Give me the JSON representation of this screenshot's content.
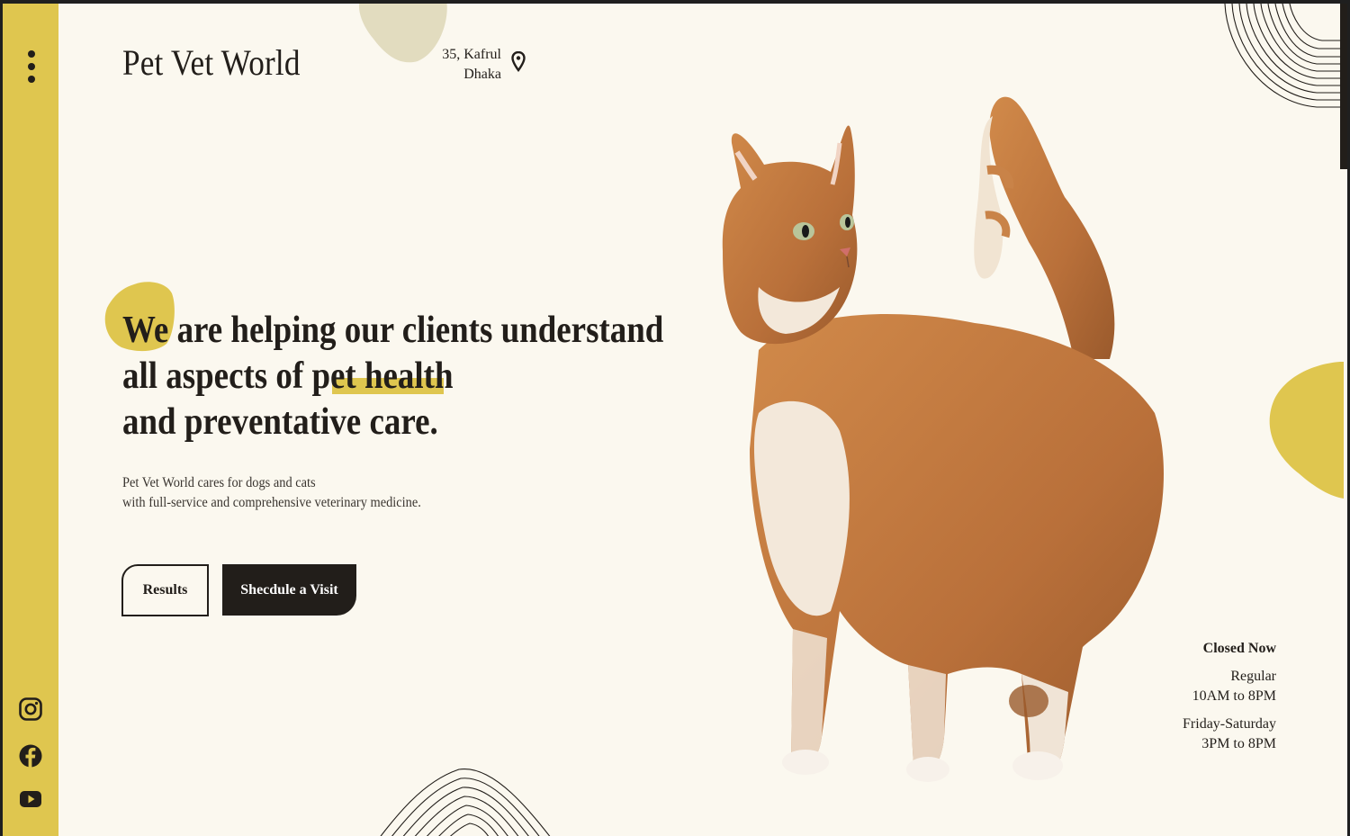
{
  "brand": {
    "name": "Pet Vet World"
  },
  "address": {
    "line1": "35, Kafrul",
    "line2": "Dhaka"
  },
  "hero": {
    "headline_line1": "We are helping our clients understand",
    "headline_line2": "all aspects of pet health",
    "headline_line3": "and preventative care.",
    "sub_line1": "Pet Vet World cares for dogs and cats",
    "sub_line2": "with full-service and comprehensive veterinary medicine."
  },
  "buttons": {
    "results": "Results",
    "schedule": "Shecdule a Visit"
  },
  "hours": {
    "status": "Closed Now",
    "regular_label": "Regular",
    "regular_time": "10AM to 8PM",
    "weekend_label": "Friday-Saturday",
    "weekend_time": "3PM to 8PM"
  },
  "icons": {
    "menu": "more-vertical-icon",
    "location": "map-pin-icon",
    "instagram": "instagram-icon",
    "facebook": "facebook-icon",
    "youtube": "youtube-icon"
  },
  "colors": {
    "accent": "#dfc64f",
    "dark": "#221e1a",
    "background": "#fbf8ef",
    "blob_top": "#e2dcbf"
  }
}
